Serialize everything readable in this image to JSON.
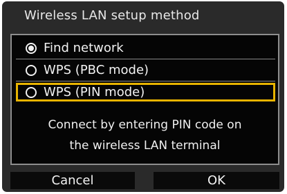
{
  "dialog": {
    "title": "Wireless LAN setup method",
    "options": [
      {
        "label": "Find network",
        "selected": true
      },
      {
        "label": "WPS (PBC mode)",
        "selected": false
      },
      {
        "label": "WPS (PIN mode)",
        "selected": false,
        "highlighted": true
      }
    ],
    "message_lines": [
      "Connect by entering PIN code on",
      "the wireless LAN terminal"
    ],
    "buttons": {
      "cancel": "Cancel",
      "ok": "OK"
    }
  },
  "colors": {
    "background": "#2a2a2a",
    "panel": "#050505",
    "highlight": "#e8b400",
    "text": "#f2f2f2"
  }
}
